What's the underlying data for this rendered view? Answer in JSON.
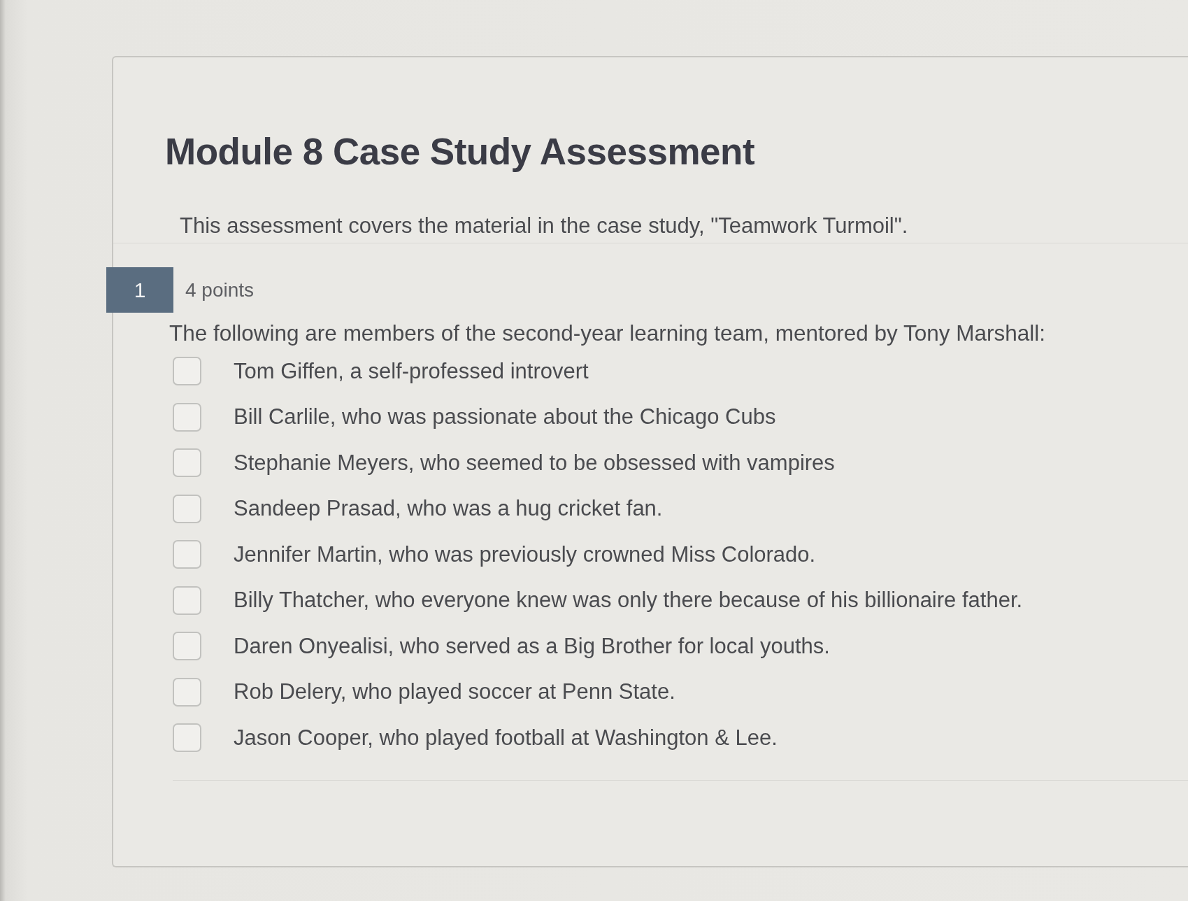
{
  "assessment": {
    "title": "Module 8 Case Study Assessment",
    "description": "This assessment covers the material in the case study, \"Teamwork Turmoil\"."
  },
  "question": {
    "number": "1",
    "points": "4 points",
    "prompt": "The following are members of the second-year learning team, mentored by Tony Marshall:",
    "options": [
      {
        "label": "Tom Giffen, a self-professed introvert",
        "checked": false
      },
      {
        "label": "Bill Carlile, who was passionate about the Chicago Cubs",
        "checked": false
      },
      {
        "label": "Stephanie Meyers, who seemed to be obsessed with vampires",
        "checked": false
      },
      {
        "label": "Sandeep Prasad, who was a hug cricket fan.",
        "checked": false
      },
      {
        "label": "Jennifer Martin, who was previously crowned Miss Colorado.",
        "checked": false
      },
      {
        "label": "Billy Thatcher, who everyone knew was only there because of his billionaire father.",
        "checked": false
      },
      {
        "label": "Daren Onyealisi, who served as a Big Brother for local youths.",
        "checked": false
      },
      {
        "label": "Rob Delery, who played soccer at Penn State.",
        "checked": false
      },
      {
        "label": "Jason Cooper, who played football at Washington & Lee.",
        "checked": false
      }
    ]
  }
}
